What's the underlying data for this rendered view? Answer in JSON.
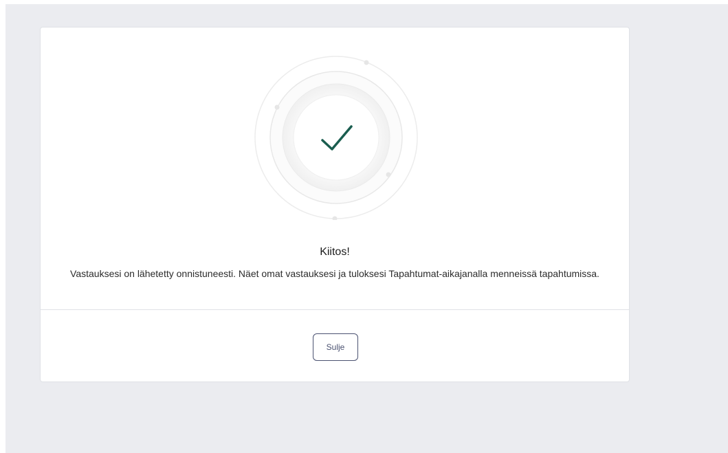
{
  "dialog": {
    "title": "Kiitos!",
    "message": "Vastauksesi on lähetetty onnistuneesti. Näet omat vastauksesi ja tuloksesi Tapahtumat-aikajanalla menneissä tapahtumissa.",
    "close_label": "Sulje",
    "success_icon": "checkmark-icon"
  },
  "colors": {
    "check": "#1a5d4f",
    "button_border": "#4a5170",
    "backdrop": "#ebecf0"
  }
}
